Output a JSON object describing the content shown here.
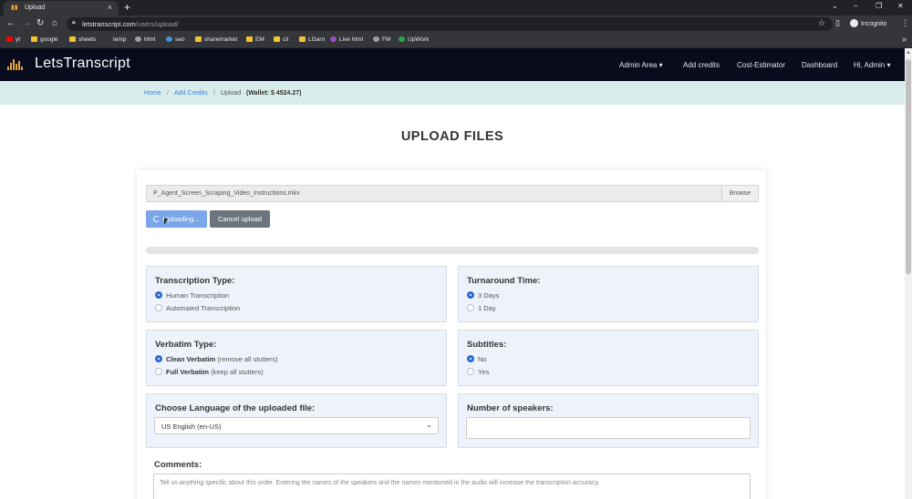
{
  "browser": {
    "tab_title": "Upload",
    "url_host": "letstranscript.com",
    "url_path": "/users/upload/",
    "incognito_label": "Incognito",
    "bookmarks": [
      {
        "label": "yt",
        "icon": "youtube-icon"
      },
      {
        "label": "google",
        "icon": "folder-icon"
      },
      {
        "label": "sheets",
        "icon": "folder-icon"
      },
      {
        "label": "temp",
        "icon": "none"
      },
      {
        "label": "html",
        "icon": "globe-icon"
      },
      {
        "label": "seo",
        "icon": "globe-icon"
      },
      {
        "label": "sharemarket",
        "icon": "folder-icon"
      },
      {
        "label": "EM",
        "icon": "folder-icon"
      },
      {
        "label": "cli",
        "icon": "folder-icon"
      },
      {
        "label": "LGarn",
        "icon": "folder-icon"
      },
      {
        "label": "Live html",
        "icon": "globe-icon"
      },
      {
        "label": "FM",
        "icon": "globe-icon"
      },
      {
        "label": "UpWork",
        "icon": "upwork-icon"
      }
    ]
  },
  "site": {
    "brand": "LetsTranscript",
    "accent": "#e8a33a",
    "nav": {
      "admin_area": "Admin Area",
      "add_credits": "Add credits",
      "cost_estimator": "Cost-Estimator",
      "dashboard": "Dashboard",
      "user": "Hi, Admin"
    }
  },
  "breadcrumb": {
    "home": "Home",
    "sep": "/",
    "add_credits": "Add Credits",
    "current": "Upload",
    "wallet": "(Wallet: $ 4524.27)"
  },
  "page": {
    "title": "UPLOAD FILES",
    "file_name": "P_Agent_Screen_Scraping_Video_Instructions.mkv",
    "browse_label": "Browse",
    "uploading_label": "Uploading...",
    "cancel_label": "Cancel upload",
    "progress_fraction": 0
  },
  "transcription": {
    "title": "Transcription Type:",
    "options": [
      {
        "label": "Human Transcription",
        "selected": true
      },
      {
        "label": "Automated Transcription",
        "selected": false
      }
    ]
  },
  "turnaround": {
    "title": "Turnaround Time:",
    "options": [
      {
        "label": "3 Days",
        "selected": true
      },
      {
        "label": "1 Day",
        "selected": false
      }
    ]
  },
  "verbatim": {
    "title": "Verbatim Type:",
    "options": [
      {
        "label": "Clean Verbatim",
        "note": "(remove all stutters)",
        "selected": true
      },
      {
        "label": "Full Verbatim",
        "note": "(keep all stutters)",
        "selected": false
      }
    ]
  },
  "subtitles": {
    "title": "Subtitles:",
    "options": [
      {
        "label": "No",
        "selected": true
      },
      {
        "label": "Yes",
        "selected": false
      }
    ]
  },
  "language": {
    "title": "Choose Language of the uploaded file:",
    "value": "US English (en-US)"
  },
  "speakers": {
    "title": "Number of speakers:",
    "value": ""
  },
  "comments": {
    "title": "Comments:",
    "placeholder": "Tell us anything specific about this order. Entering the names of the speakers and the names mentioned in the audio will increase the transcription accuracy."
  }
}
